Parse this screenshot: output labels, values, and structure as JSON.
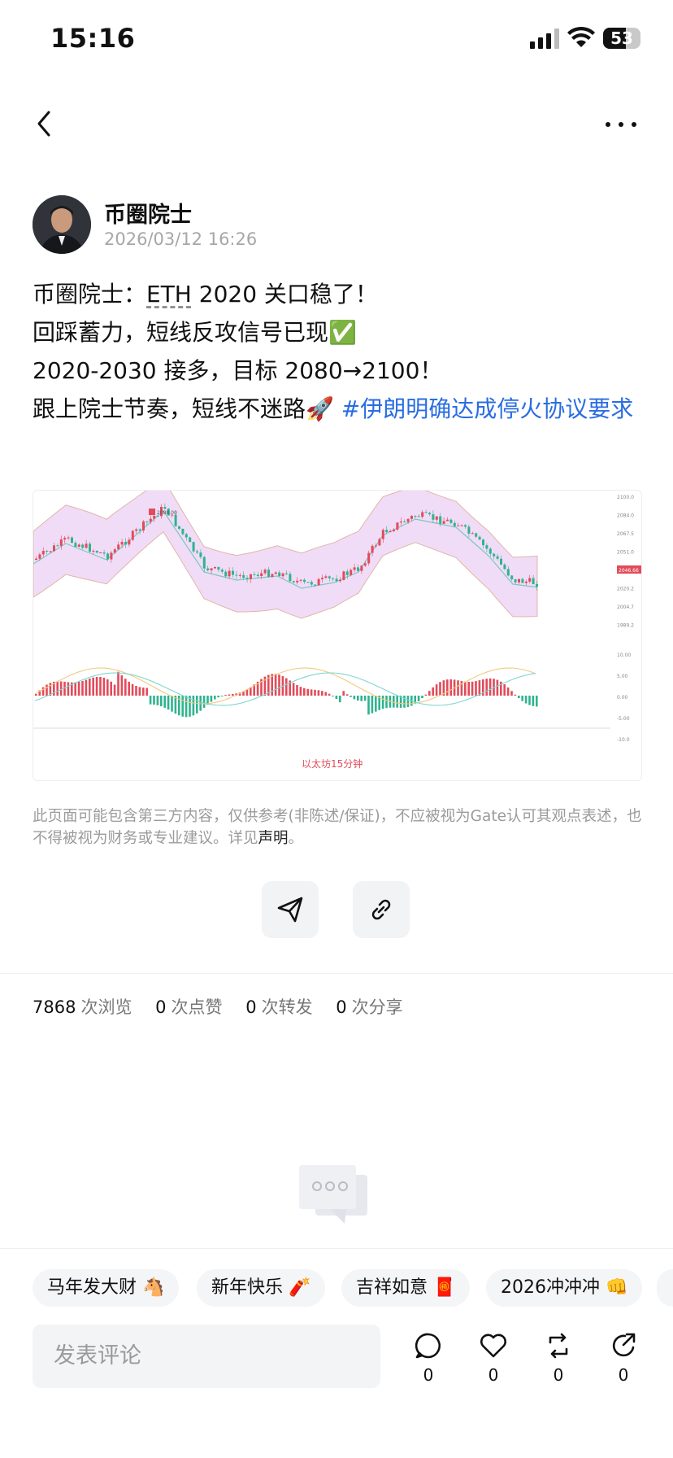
{
  "status_bar": {
    "time": "15:16",
    "battery": "53"
  },
  "author": {
    "name": "币圈院士",
    "date": "2026/03/12 16:26"
  },
  "post": {
    "line1_prefix": "币圈院士：",
    "line1_eth": "ETH",
    "line1_suffix": " 2020 关口稳了！",
    "line2": "回踩蓄力，短线反攻信号已现✅",
    "line3": "2020-2030 接多，目标 2080→2100！",
    "line4": "跟上院士节奏，短线不迷路🚀 ",
    "hashtag": "#伊朗明确达成停火协议要求"
  },
  "chart": {
    "peak_label": "2088.00",
    "price_tag": "2046.66",
    "watermark": "以太坊15分钟",
    "price_ticks": [
      "2100.0",
      "2084.0",
      "2067.5",
      "2051.0",
      "2035.1",
      "2020.2",
      "2004.7",
      "1989.2"
    ],
    "macd_ticks": [
      "10.00",
      "5.00",
      "0.00",
      "-5.00",
      "-10.0"
    ]
  },
  "disclaimer": {
    "text": "此页面可能包含第三方内容，仅供参考(非陈述/保证)，不应被视为Gate认可其观点表述，也不得被视为财务或专业建议。详见",
    "link": "声明",
    "end": "。"
  },
  "stats": {
    "views": "7868",
    "views_label": "次浏览",
    "likes": "0",
    "likes_label": "次点赞",
    "reposts": "0",
    "reposts_label": "次转发",
    "shares": "0",
    "shares_label": "次分享"
  },
  "chips": [
    "马年发大财 🐴",
    "新年快乐 🧨",
    "吉祥如意 🧧",
    "2026冲冲冲 👊"
  ],
  "comment_placeholder": "发表评论",
  "actions": {
    "comment": "0",
    "like": "0",
    "repost": "0",
    "share": "0"
  }
}
